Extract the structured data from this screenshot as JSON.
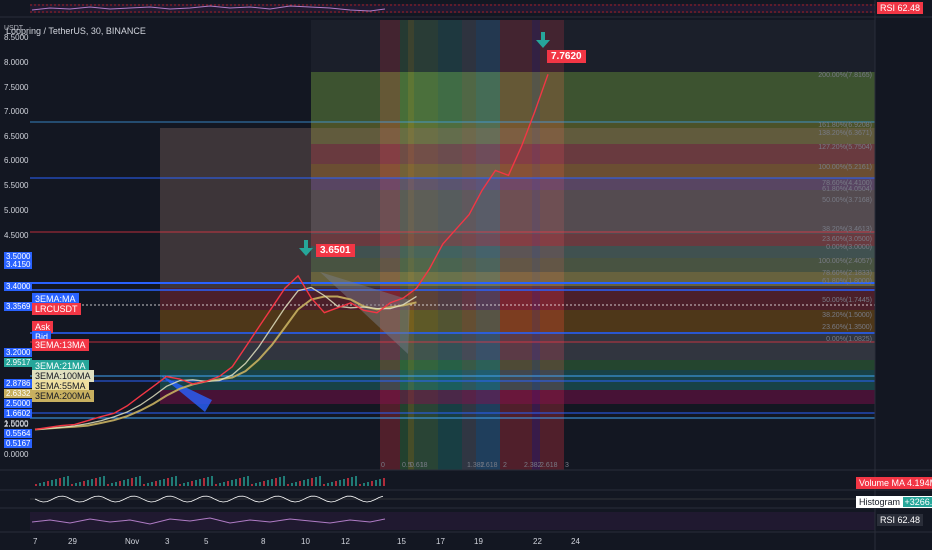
{
  "header": {
    "currency": "USDT",
    "title": "Loopring / TetherUS, 30, BINANCE"
  },
  "rsi_top": {
    "label": "RSI",
    "value": "62.48"
  },
  "price_axis": {
    "ticks": [
      "8.5000",
      "8.0000",
      "7.5000",
      "7.0000",
      "6.5000",
      "6.0000",
      "5.5000",
      "5.0000",
      "4.5000",
      "4.0000",
      "3.5000",
      "3.4150",
      "3.4000",
      "3.3569",
      "3.2000",
      "2.9517",
      "2.8786",
      "2.6332",
      "2.5000",
      "2.0000",
      "1.6602",
      "1.5000",
      "1.0000",
      "0.5564",
      "0.5167",
      "0.0000"
    ]
  },
  "left_labels": [
    {
      "text": "3EMA:MA",
      "color": "#2962ff"
    },
    {
      "text": "LRCUSDT",
      "color": "#f23645"
    },
    {
      "text": "Ask",
      "color": "#f23645"
    },
    {
      "text": "Bid",
      "color": "#2962ff"
    },
    {
      "text": "3EMA:13MA",
      "color": "#f23645"
    },
    {
      "text": "3EMA:21MA",
      "color": "#26a69a"
    },
    {
      "text": "3EMA:100MA",
      "color": "#e0e0c0"
    },
    {
      "text": "3EMA:55MA",
      "color": "#f0e0a0"
    },
    {
      "text": "3EMA:200MA",
      "color": "#c8b060"
    }
  ],
  "callouts": [
    {
      "text": "3.6501"
    },
    {
      "text": "7.7620"
    }
  ],
  "fib_labels": [
    "200.00%(7.8165)",
    "161.80%(6.9208)",
    "138.20%(6.3671)",
    "127.20%(5.7504)",
    "100.00%(5.2161)",
    "78.60%(4.4100)",
    "61.80%(4.0504)",
    "50.00%(3.7168)",
    "38.20%(3.4613)",
    "23.60%(3.0500)",
    "0.00%(3.0000)",
    "100.00%(2.4057)",
    "78.60%(2.1833)",
    "61.80%(1.8000)",
    "50.00%(1.7445)",
    "38.20%(1.5000)",
    "23.60%(1.3500)",
    "0.00%(1.0825)"
  ],
  "time_fib_labels": [
    "0",
    "0.5",
    "0.618",
    "1",
    "1.382",
    "1.618",
    "2",
    "2.382",
    "2.618",
    "3"
  ],
  "volume": {
    "label": "Volume MA",
    "value": "4.194M"
  },
  "macd": {
    "label": "Histogram",
    "value": "+3266.23%"
  },
  "rsi_bottom": {
    "label": "RSI",
    "value": "62.48"
  },
  "time_axis": [
    "7",
    "29",
    "Nov",
    "3",
    "5",
    "8",
    "10",
    "12",
    "15",
    "17",
    "19",
    "22",
    "24"
  ],
  "colors": {
    "background": "#131722",
    "up": "#26a69a",
    "down": "#f23645",
    "accent_blue": "#2962ff",
    "arrow_green": "#26a69a"
  },
  "chart_data": {
    "type": "line",
    "title": "Loopring / TetherUS, 30, BINANCE",
    "ylim": [
      0,
      8.5
    ],
    "series": [
      {
        "values": [
          0.52,
          0.56,
          0.6,
          0.62,
          0.7,
          0.78,
          0.85,
          1.0,
          1.2,
          1.4,
          1.6,
          1.55,
          1.45,
          1.5,
          1.6,
          1.8,
          2.2,
          2.6,
          3.0,
          3.4,
          3.65,
          3.2,
          2.9,
          3.0,
          3.1,
          2.95,
          2.9,
          3.1,
          3.2,
          3.4,
          3.8,
          4.3,
          4.6,
          4.9,
          5.4,
          5.8,
          5.7,
          6.3,
          7.0,
          7.76
        ]
      }
    ]
  }
}
